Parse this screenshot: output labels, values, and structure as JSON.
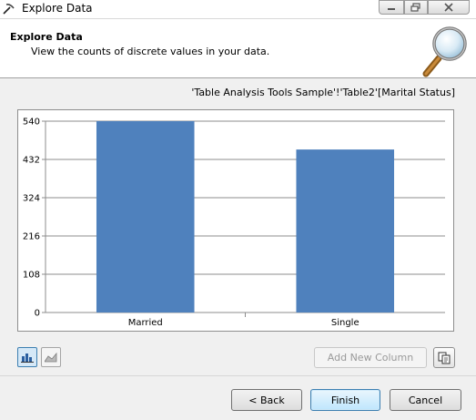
{
  "window": {
    "title": "Explore Data",
    "icon": "pickaxe-icon"
  },
  "header": {
    "title": "Explore Data",
    "subtitle": "View the counts of discrete values in your data.",
    "icon": "magnifying-glass-icon"
  },
  "source_label": "'Table Analysis Tools Sample'!'Table2'[Marital Status]",
  "chart_data": {
    "type": "bar",
    "categories": [
      "Married",
      "Single"
    ],
    "values": [
      540,
      460
    ],
    "ylim": [
      0,
      540
    ],
    "yticks": [
      0,
      108,
      216,
      324,
      432,
      540
    ],
    "grid": true,
    "bar_color": "#4f81bd",
    "title": "",
    "xlabel": "",
    "ylabel": ""
  },
  "view_buttons": {
    "bar": "bar-chart-icon",
    "area": "area-chart-icon"
  },
  "add_column_label": "Add New Column",
  "copy_icon": "copy-icon",
  "footer": {
    "back": "< Back",
    "finish": "Finish",
    "cancel": "Cancel"
  }
}
